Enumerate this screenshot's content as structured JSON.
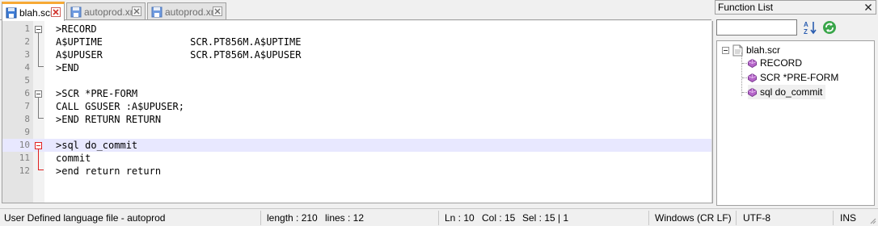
{
  "tabs": [
    {
      "label": "blah.scr",
      "active": true
    },
    {
      "label": "autoprod.xml",
      "active": false
    },
    {
      "label": "autoprod.xml",
      "active": false
    }
  ],
  "editor": {
    "lines": [
      {
        "num": "1",
        "text": ">RECORD"
      },
      {
        "num": "2",
        "text": "A$UPTIME               SCR.PT856M.A$UPTIME"
      },
      {
        "num": "3",
        "text": "A$UPUSER               SCR.PT856M.A$UPUSER"
      },
      {
        "num": "4",
        "text": ">END"
      },
      {
        "num": "5",
        "text": ""
      },
      {
        "num": "6",
        "text": ">SCR *PRE-FORM"
      },
      {
        "num": "7",
        "text": "CALL GSUSER :A$UPUSER;"
      },
      {
        "num": "8",
        "text": ">END RETURN RETURN"
      },
      {
        "num": "9",
        "text": ""
      },
      {
        "num": "10",
        "text": ">sql do_commit"
      },
      {
        "num": "11",
        "text": "commit"
      },
      {
        "num": "12",
        "text": ">end return return"
      }
    ],
    "current_line": 10
  },
  "function_list": {
    "title": "Function List",
    "search_value": "",
    "root": "blah.scr",
    "items": [
      {
        "label": "RECORD"
      },
      {
        "label": "SCR *PRE-FORM"
      },
      {
        "label": "sql do_commit"
      }
    ],
    "selected_index": 2
  },
  "status": {
    "lang": "User Defined language file - autoprod",
    "length": "length : 210",
    "lines": "lines : 12",
    "ln": "Ln : 10",
    "col": "Col : 15",
    "sel": "Sel : 15 | 1",
    "eol": "Windows (CR LF)",
    "encoding": "UTF-8",
    "mode": "INS"
  },
  "colors": {
    "accent_tab": "#f7a935",
    "current_line_bg": "#e8e8ff",
    "fold_marker_active": "#e02020"
  }
}
